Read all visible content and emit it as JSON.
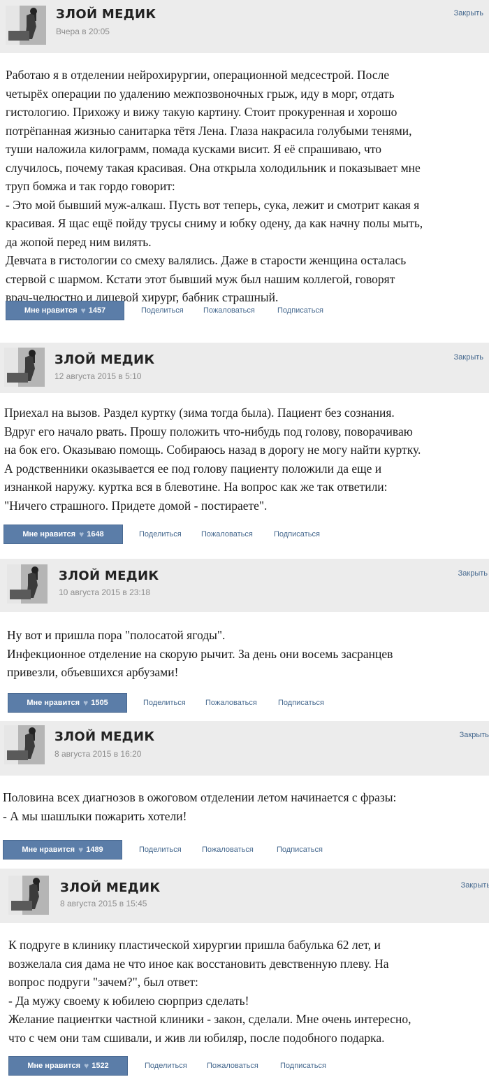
{
  "posts": [
    {
      "author": "ЗЛОЙ МЕДИК",
      "date": "Вчера в 20:05",
      "close": "Закрыть",
      "text": "Работаю я в отделении нейрохирургии, операционной медсестрой. После\nчетырёх операции по удалению межпозвоночных грыж, иду в морг, отдать\nгистологию. Прихожу и вижу такую картину. Стоит прокуренная и хорошо\nпотрёпанная жизнью санитарка тётя Лена. Глаза накрасила голубыми тенями,\nтуши наложила килограмм, помада кусками висит. Я её спрашиваю, что\nслучилось, почему такая красивая. Она открыла холодильник и показывает мне\nтруп бомжа и так гордо говорит:\n- Это мой бывший муж-алкаш. Пусть вот теперь, сука, лежит и смотрит какая я\nкрасивая. Я щас ещё пойду трусы сниму и юбку одену, да как начну полы мыть,\nда жопой перед ним вилять.\nДевчата в гистологии со смеху валялись. Даже в старости женщина осталась\nстервой с шармом. Кстати этот бывший муж был нашим коллегой, говорят\nврач-челюстно и лицевой хирург, бабник страшный.",
      "like_label": "Мне нравится",
      "likes": "1457",
      "share": "Поделиться",
      "report": "Пожаловаться",
      "subscribe": "Подписаться"
    },
    {
      "author": "ЗЛОЙ МЕДИК",
      "date": "12 августа 2015 в 5:10",
      "close": "Закрыть",
      "text": "Приехал на вызов. Раздел куртку (зима тогда была). Пациент без сознания.\nВдруг его начало рвать. Прошу положить что-нибудь под голову, поворачиваю\nна бок его. Оказываю помощь. Собираюсь назад в дорогу не могу найти куртку.\nА родственники оказывается ее под голову пациенту положили да еще и\nизнанкой наружу. куртка вся в блевотине. На вопрос как же так ответили:\n\"Ничего страшного. Придете домой - постираете\".",
      "like_label": "Мне нравится",
      "likes": "1648",
      "share": "Поделиться",
      "report": "Пожаловаться",
      "subscribe": "Подписаться"
    },
    {
      "author": "ЗЛОЙ МЕДИК",
      "date": "10 августа 2015 в 23:18",
      "close": "Закрыть",
      "text": "Ну вот и пришла пора \"полосатой ягоды\".\nИнфекционное отделение на скорую рычит. За день они восемь засранцев\nпривезли, объевшихся арбузами!",
      "like_label": "Мне нравится",
      "likes": "1505",
      "share": "Поделиться",
      "report": "Пожаловаться",
      "subscribe": "Подписаться"
    },
    {
      "author": "ЗЛОЙ МЕДИК",
      "date": "8 августа 2015 в 16:20",
      "close": "Закрыть",
      "text": "Половина всех диагнозов в ожоговом отделении летом начинается с фразы:\n- А мы шашлыки пожарить хотели!",
      "like_label": "Мне нравится",
      "likes": "1489",
      "share": "Поделиться",
      "report": "Пожаловаться",
      "subscribe": "Подписаться"
    },
    {
      "author": "ЗЛОЙ МЕДИК",
      "date": "8 августа 2015 в 15:45",
      "close": "Закрыть",
      "text": "К подруге в клинику пластической хирургии пришла бабулька 62 лет, и\nвозжелала сия дама не что иное как восстановить девственную плеву. На\nвопрос подруги \"зачем?\", был ответ:\n- Да мужу своему к юбилею сюрприз сделать!\nЖелание пациентки частной клиники - закон, сделали. Мне очень интересно,\nчто с чем они там сшивали, и жив ли юбиляр, после подобного подарка.",
      "like_label": "Мне нравится",
      "likes": "1522",
      "share": "Поделиться",
      "report": "Пожаловаться",
      "subscribe": "Подписаться"
    }
  ]
}
